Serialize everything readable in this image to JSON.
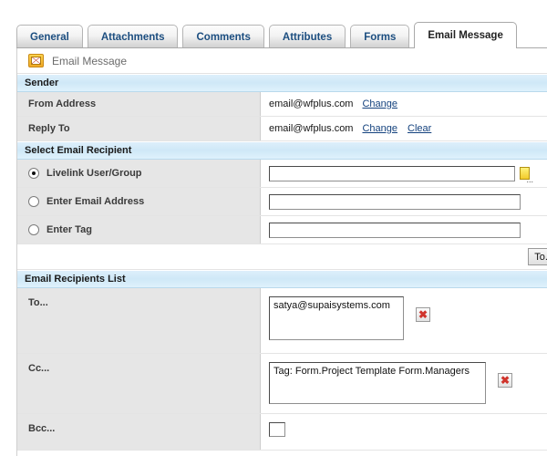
{
  "tabs": [
    {
      "label": "General",
      "active": false
    },
    {
      "label": "Attachments",
      "active": false
    },
    {
      "label": "Comments",
      "active": false
    },
    {
      "label": "Attributes",
      "active": false
    },
    {
      "label": "Forms",
      "active": false
    },
    {
      "label": "Email Message",
      "active": true
    }
  ],
  "panel": {
    "title": "Email Message",
    "icon": "email-envelope-icon"
  },
  "sender": {
    "section_label": "Sender",
    "rows": [
      {
        "label": "From Address",
        "value": "email@wfplus.com",
        "links": [
          "Change"
        ]
      },
      {
        "label": "Reply To",
        "value": "email@wfplus.com",
        "links": [
          "Change",
          "Clear"
        ]
      }
    ]
  },
  "select_recipient": {
    "section_label": "Select Email Recipient",
    "options": [
      {
        "label": "Livelink User/Group",
        "selected": true,
        "input_value": "",
        "input_placeholder": "",
        "has_browse": true,
        "browse_icon": "browse-folder-icon"
      },
      {
        "label": "Enter Email Address",
        "selected": false,
        "input_value": "",
        "input_placeholder": "",
        "has_browse": false
      },
      {
        "label": "Enter Tag",
        "selected": false,
        "input_value": "",
        "input_placeholder": "",
        "has_browse": false
      }
    ],
    "to_button_label": "To..."
  },
  "recipients_list": {
    "section_label": "Email Recipients List",
    "rows": [
      {
        "label": "To...",
        "value": "satya@supaisystems.com",
        "delete_icon": "delete-x-icon"
      },
      {
        "label": "Cc...",
        "value": "Tag: Form.Project Template Form.Managers",
        "delete_icon": "delete-x-icon"
      },
      {
        "label": "Bcc...",
        "value": "",
        "delete_icon": "delete-x-icon"
      }
    ]
  },
  "colors": {
    "section_header_bg": "#cfe8f7",
    "row_label_bg": "#e6e6e6",
    "tab_text": "#1c4e80",
    "link": "#14427e",
    "delete_red": "#d0342c",
    "icon_gold": "#f0a825"
  }
}
